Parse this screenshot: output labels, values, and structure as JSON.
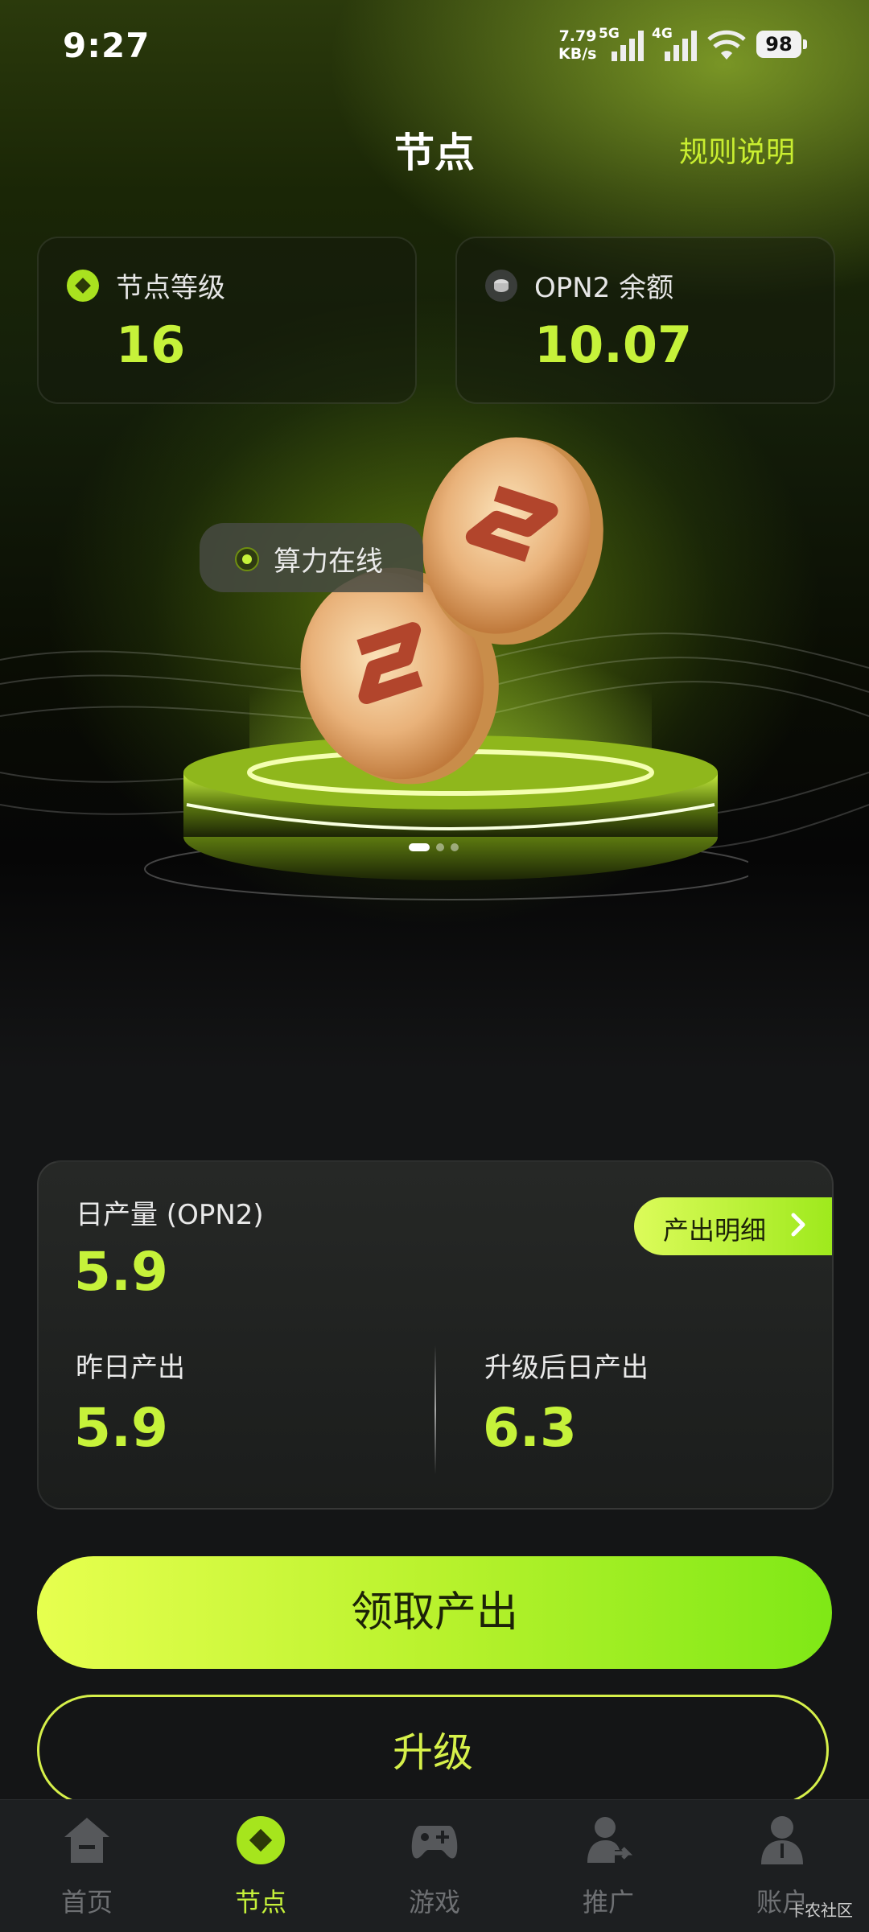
{
  "status_bar": {
    "time": "9:27",
    "speed_value": "7.79",
    "speed_unit": "KB/s",
    "net1": "5G",
    "net2": "4G",
    "battery": "98"
  },
  "header": {
    "title": "节点",
    "rules_link": "规则说明"
  },
  "stats": {
    "node_level_label": "节点等级",
    "node_level_value": "16",
    "balance_label": "OPN2 余额",
    "balance_value": "10.07"
  },
  "hero": {
    "online_badge": "算力在线",
    "carousel_total": 3,
    "carousel_active": 1
  },
  "production": {
    "daily_label": "日产量 (OPN2)",
    "daily_value": "5.9",
    "detail_button": "产出明细",
    "yesterday_label": "昨日产出",
    "yesterday_value": "5.9",
    "upgraded_label": "升级后日产出",
    "upgraded_value": "6.3"
  },
  "actions": {
    "claim": "领取产出",
    "upgrade": "升级"
  },
  "tabbar": {
    "items": [
      {
        "label": "首页",
        "icon": "home-icon"
      },
      {
        "label": "节点",
        "icon": "node-icon"
      },
      {
        "label": "游戏",
        "icon": "gamepad-icon"
      },
      {
        "label": "推广",
        "icon": "promote-icon"
      },
      {
        "label": "账户",
        "icon": "account-icon"
      }
    ],
    "active_index": 1
  },
  "watermark": "卡农社区",
  "colors": {
    "accent": "#c6f23a",
    "background": "#141516",
    "card": "#1f2120"
  }
}
